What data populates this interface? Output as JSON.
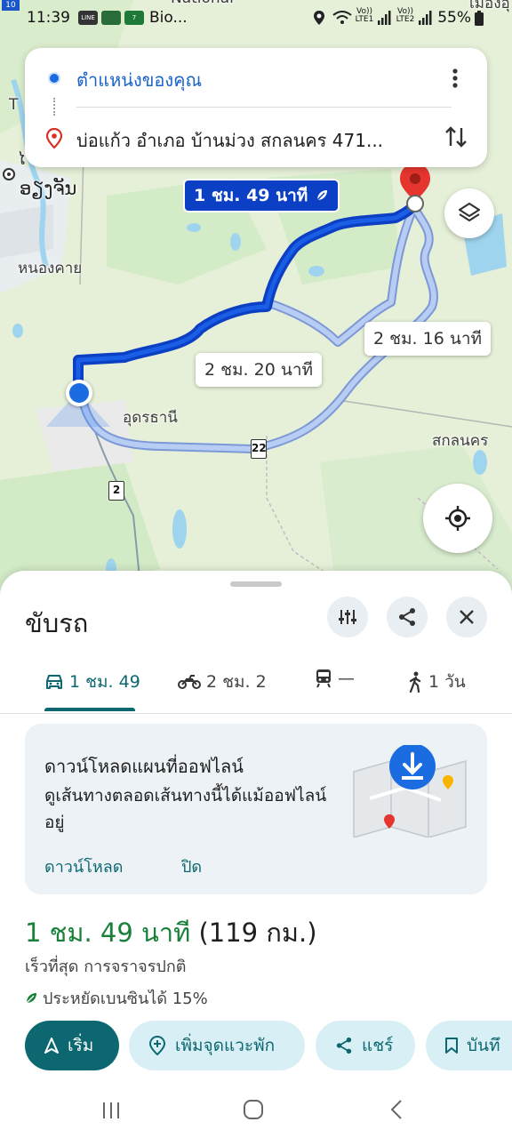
{
  "status_bar": {
    "time": "11:39",
    "battery": "55%",
    "corner_badge": "10",
    "app_icons": [
      "LINE",
      "Bio...",
      "7"
    ],
    "sim1": "Vo)) LTE1",
    "sim2": "Vo)) LTE2"
  },
  "search": {
    "origin": "ตำแหน่งของคุณ",
    "destination": "บ่อแก้ว อำเภอ บ้านม่วง สกลนคร 471..."
  },
  "map": {
    "labels": {
      "national": "National",
      "bio": "Bio...",
      "udon_small": "อุดรธานี",
      "t_letter": "T",
      "nongkhai": "หนองคาย",
      "sakon": "สกลนคร",
      "vientiane": "ອຽງຈັນ",
      "corner_top_right": "เมืองอุ",
      "l_edge": "ໄ"
    },
    "highway_22": "22",
    "highway_2": "2",
    "route_tags": {
      "main": "1 ชม. 49 นาที",
      "alt1": "2 ชม. 16 นาที",
      "alt2": "2 ชม. 20 นาที"
    },
    "colors": {
      "main_route": "#0b3fc4",
      "alt_route": "#a9c2f0",
      "water": "#9fd4ee",
      "land": "#e6f0d8"
    }
  },
  "sheet": {
    "title": "ขับรถ",
    "modes": [
      {
        "icon": "car-icon",
        "label": "1 ชม. 49"
      },
      {
        "icon": "motorcycle-icon",
        "label": "2 ชม. 2"
      },
      {
        "icon": "transit-icon",
        "label": "—"
      },
      {
        "icon": "walk-icon",
        "label": "1 วัน"
      }
    ],
    "offline": {
      "title": "ดาวน์โหลดแผนที่ออฟไลน์",
      "desc": "ดูเส้นทางตลอดเส้นทางนี้ได้แม้ออฟไลน์อยู่",
      "download": "ดาวน์โหลด",
      "close": "ปิด"
    },
    "summary": {
      "time": "1 ชม. 49 นาที",
      "distance": "(119 กม.)",
      "note": "เร็วที่สุด การจราจรปกติ",
      "fuel": "ประหยัดเบนซินได้ 15%"
    },
    "chips": {
      "start": "เริ่ม",
      "add_stop": "เพิ่มจุดแวะพัก",
      "share": "แชร์",
      "save": "บันทึ"
    }
  }
}
